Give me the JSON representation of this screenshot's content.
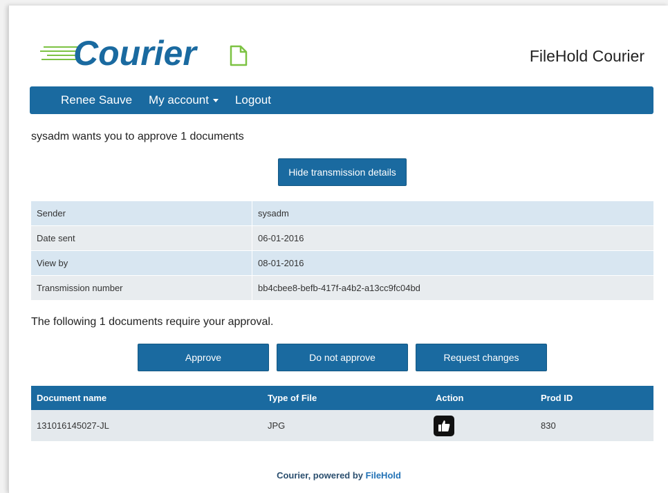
{
  "brand": {
    "logo_text": "Courier",
    "app_title": "FileHold Courier"
  },
  "nav": {
    "user": "Renee Sauve",
    "account": "My account",
    "logout": "Logout"
  },
  "intro_text": "sysadm wants you to approve 1 documents",
  "hide_details_label": "Hide transmission details",
  "details": [
    {
      "label": "Sender",
      "value": "sysadm"
    },
    {
      "label": "Date sent",
      "value": "06-01-2016"
    },
    {
      "label": "View by",
      "value": "08-01-2016"
    },
    {
      "label": "Transmission number",
      "value": "bb4cbee8-befb-417f-a4b2-a13cc9fc04bd"
    }
  ],
  "approval_text": "The following 1 documents require your approval.",
  "actions": {
    "approve": "Approve",
    "not_approve": "Do not approve",
    "request_changes": "Request changes"
  },
  "documents": {
    "headers": [
      "Document name",
      "Type of File",
      "Action",
      "Prod ID"
    ],
    "rows": [
      {
        "name": "131016145027-JL",
        "type": "JPG",
        "action_icon": "thumbs-up-icon",
        "prod_id": "830"
      }
    ]
  },
  "footer": {
    "prefix": "Courier, powered by ",
    "link": "FileHold"
  },
  "colors": {
    "primary": "#1a6aa0",
    "logo_blue": "#1a6aa0",
    "logo_green": "#7cc242",
    "row_alt": "#d8e6f1"
  }
}
